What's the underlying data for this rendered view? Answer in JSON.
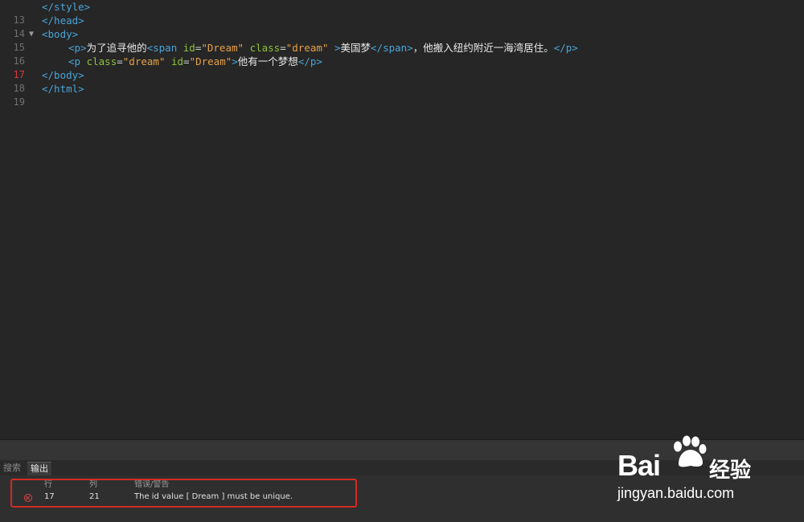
{
  "editor": {
    "lines": [
      {
        "num": "13",
        "error": false,
        "fold": ""
      },
      {
        "num": "14",
        "error": false,
        "fold": ""
      },
      {
        "num": "15",
        "error": false,
        "fold": "▼"
      },
      {
        "num": "16",
        "error": false,
        "fold": ""
      },
      {
        "num": "17",
        "error": true,
        "fold": ""
      },
      {
        "num": "18",
        "error": false,
        "fold": ""
      },
      {
        "num": "19",
        "error": false,
        "fold": ""
      }
    ],
    "code": {
      "l13": "</style>",
      "l14": "</head>",
      "l15": "<body>",
      "l16": {
        "p_open": "<p>",
        "text1": "为了追寻他的",
        "span_open_tag": "<span",
        "attr_id": "id",
        "eq": "=",
        "val_id": "\"Dream\"",
        "attr_class": "class",
        "val_class": "\"dream\"",
        "gt": ">",
        "text2": "美国梦",
        "span_close": "</span>",
        "text3": "，他搬入纽约附近一海湾居住。",
        "p_close": "</p>"
      },
      "l17": {
        "p_open_tag": "<p",
        "attr_class": "class",
        "eq": "=",
        "val_class": "\"dream\"",
        "attr_id": "id",
        "val_id": "\"Dream\"",
        "gt": ">",
        "text": "他有一个梦想",
        "p_close": "</p>"
      },
      "l18": "</body>",
      "l19": "</html>"
    }
  },
  "panel": {
    "tabs": [
      {
        "label": "搜索",
        "active": false
      },
      {
        "label": "输出",
        "active": true
      }
    ],
    "columns": {
      "line": "行",
      "col": "列",
      "message": "错误/警告"
    },
    "rows": [
      {
        "line": "17",
        "col": "21",
        "message": "The id value [ Dream ] must be unique."
      }
    ]
  },
  "watermark": {
    "brand": "Bai",
    "brand2": "经验",
    "url": "jingyan.baidu.com"
  },
  "colors": {
    "tag": "#4aa4d8",
    "attr": "#8fc23f",
    "string": "#e6a24a",
    "error": "#d8393b",
    "highlight_box": "#d42a22"
  }
}
